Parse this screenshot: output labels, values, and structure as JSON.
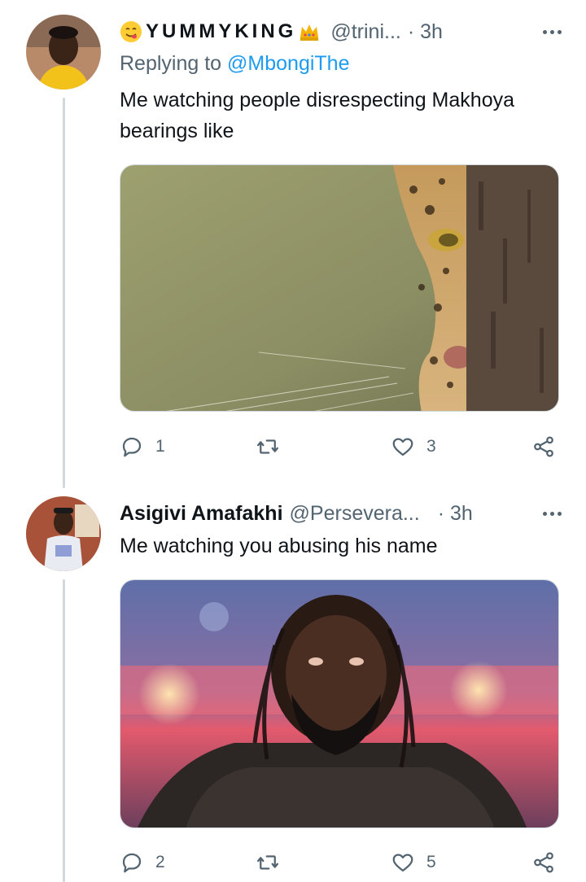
{
  "tweets": [
    {
      "display_name": "YUMMYKING",
      "handle": "@trini...",
      "time": "· 3h",
      "replying_prefix": "Replying to",
      "replying_to": "@MbongiThe",
      "text": "Me watching people disrespecting Makhoya bearings like",
      "media_icon": "leopard-photo",
      "reply_count": "1",
      "retweet_count": "",
      "like_count": "3"
    },
    {
      "display_name": "Asigivi Amafakhi",
      "handle": "@Persevera...",
      "time": "· 3h",
      "text": "Me watching you abusing his name",
      "media_icon": "wrestler-photo",
      "reply_count": "2",
      "retweet_count": "",
      "like_count": "5"
    }
  ],
  "icons": {
    "reply": "speech-bubble-icon",
    "retweet": "retweet-icon",
    "like": "heart-icon",
    "share": "share-icon",
    "more": "more-dots-icon"
  },
  "colors": {
    "accent": "#1d9bf0",
    "muted": "#536471",
    "text": "#0f1419",
    "border": "#cfd9de"
  }
}
